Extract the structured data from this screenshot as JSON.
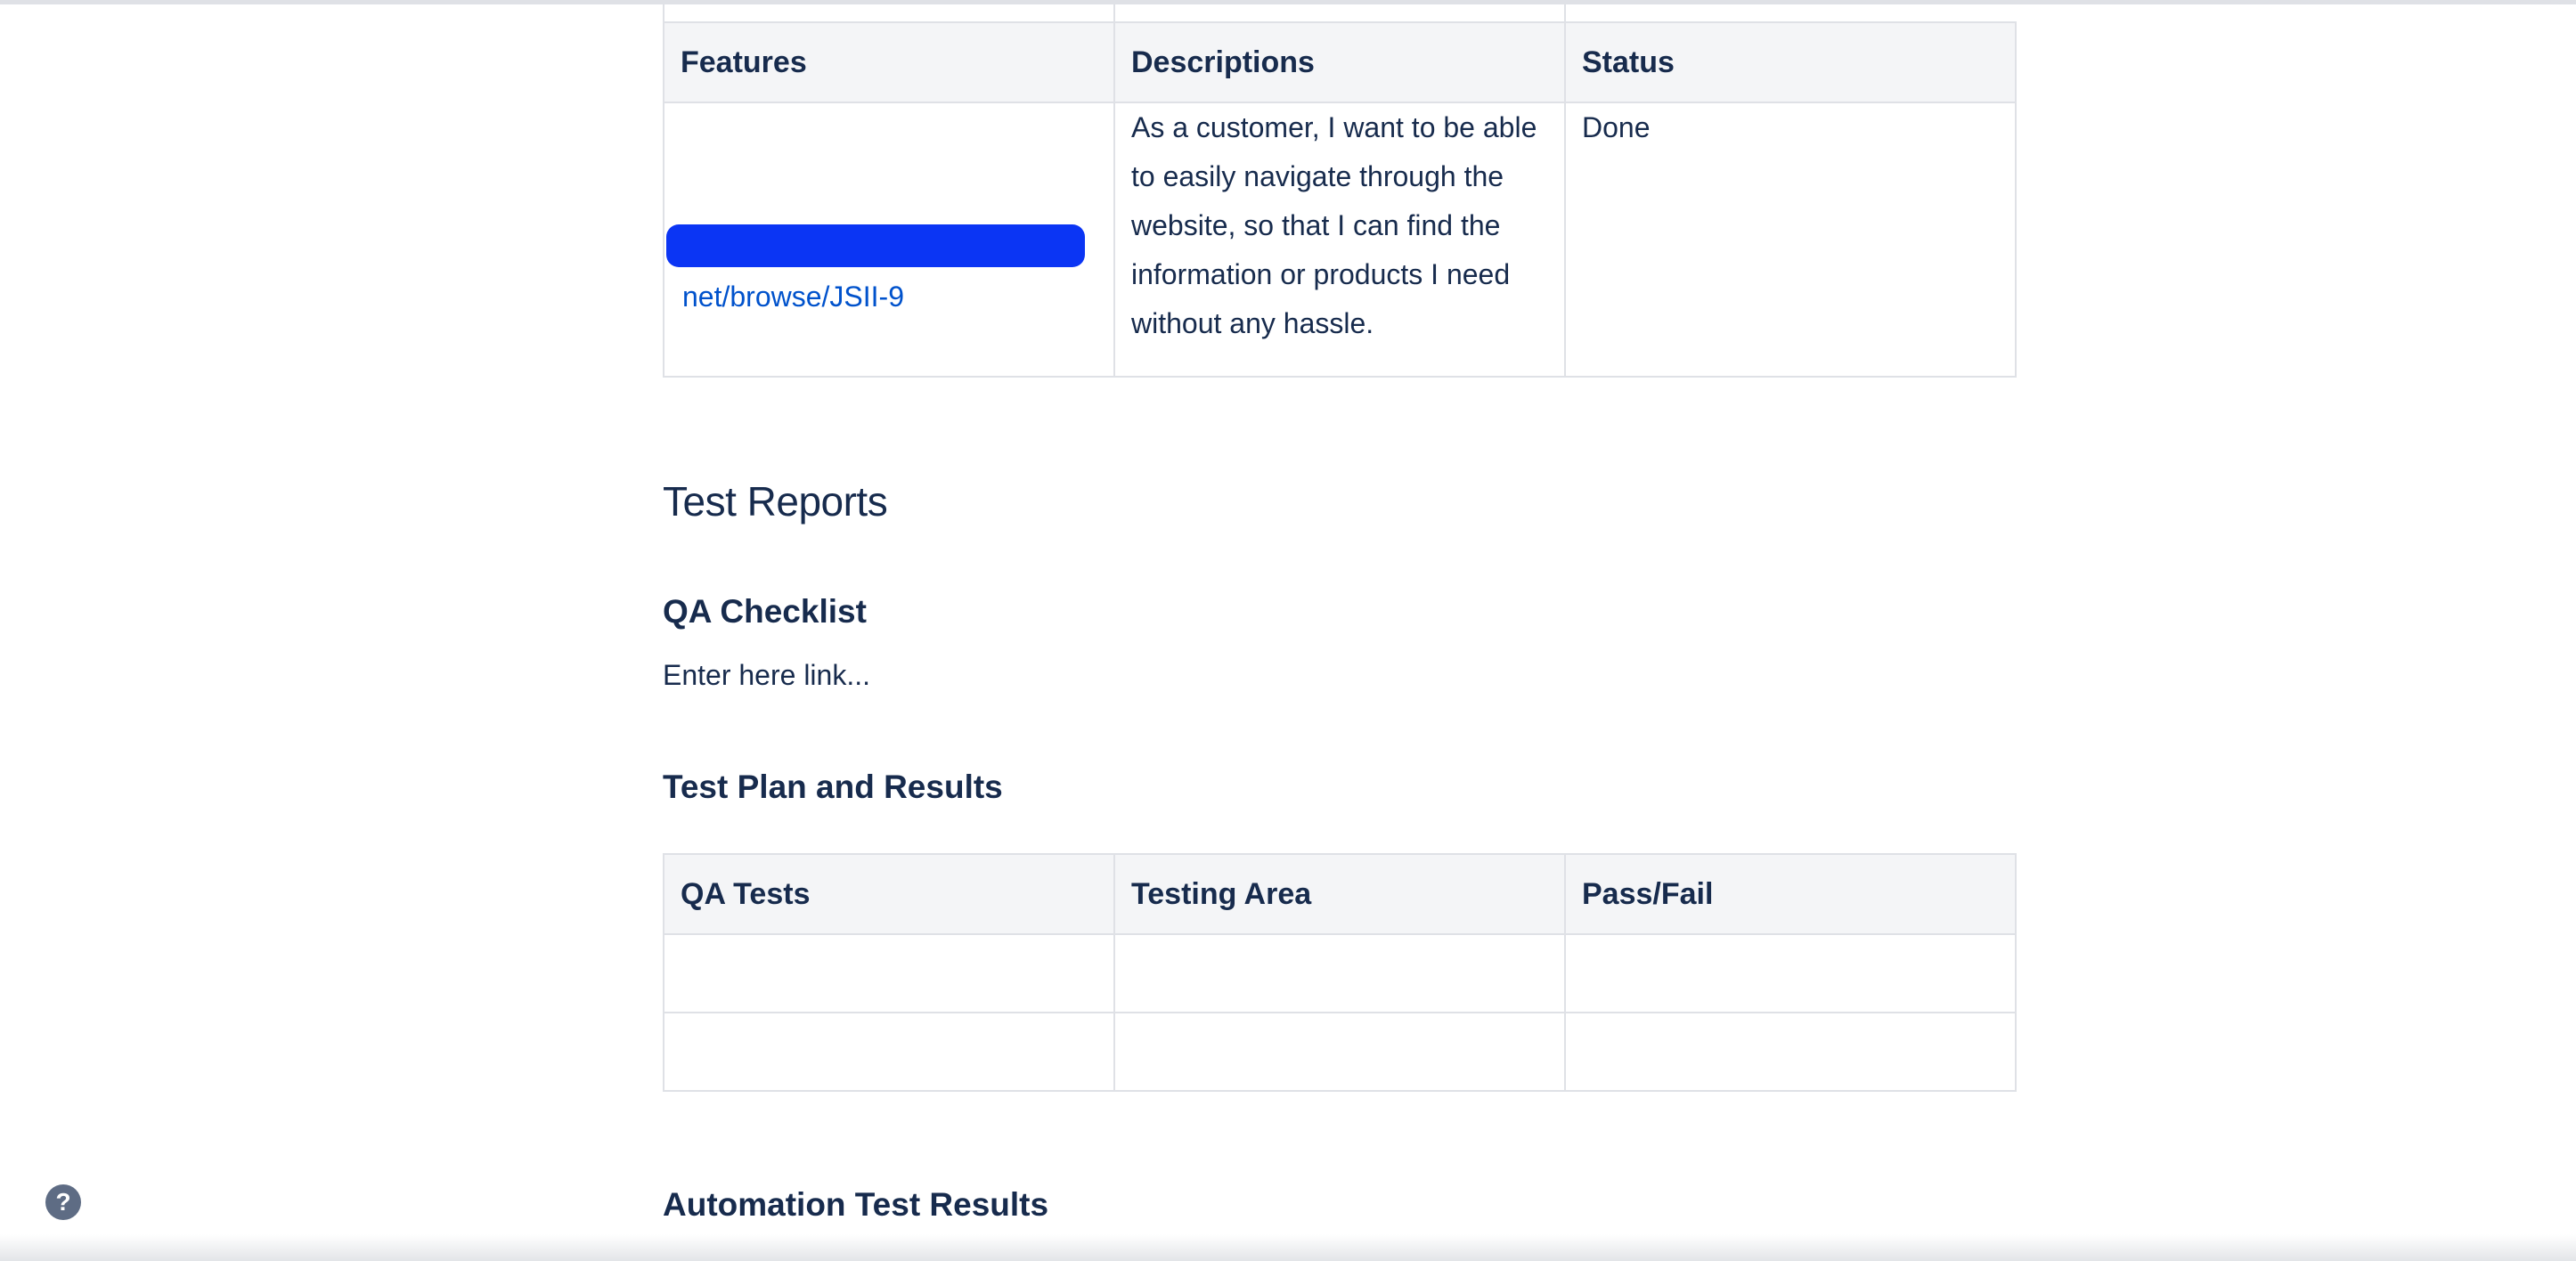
{
  "features_table": {
    "headers": [
      "Features",
      "Descriptions",
      "Status"
    ],
    "rows": [
      {
        "feature_link": "net/browse/JSII-9",
        "description": "As a customer, I want to be able to easily navigate through the website, so that I can find the information or products I need without any hassle.",
        "status": "Done"
      }
    ]
  },
  "test_reports": {
    "title": "Test Reports",
    "qa_checklist": {
      "title": "QA Checklist",
      "placeholder_text": "Enter here link..."
    },
    "test_plan": {
      "title": "Test Plan and Results",
      "headers": [
        "QA Tests",
        "Testing Area",
        "Pass/Fail"
      ],
      "rows": [
        [
          "",
          "",
          ""
        ],
        [
          "",
          "",
          ""
        ]
      ]
    },
    "automation": {
      "title": "Automation Test Results"
    }
  },
  "help": {
    "icon": "question-mark-icon",
    "glyph": "?"
  },
  "colors": {
    "text": "#172b4d",
    "link": "#0052cc",
    "header_bg": "#f4f5f7",
    "border": "#dfe1e6",
    "redaction": "#0b35f4"
  }
}
